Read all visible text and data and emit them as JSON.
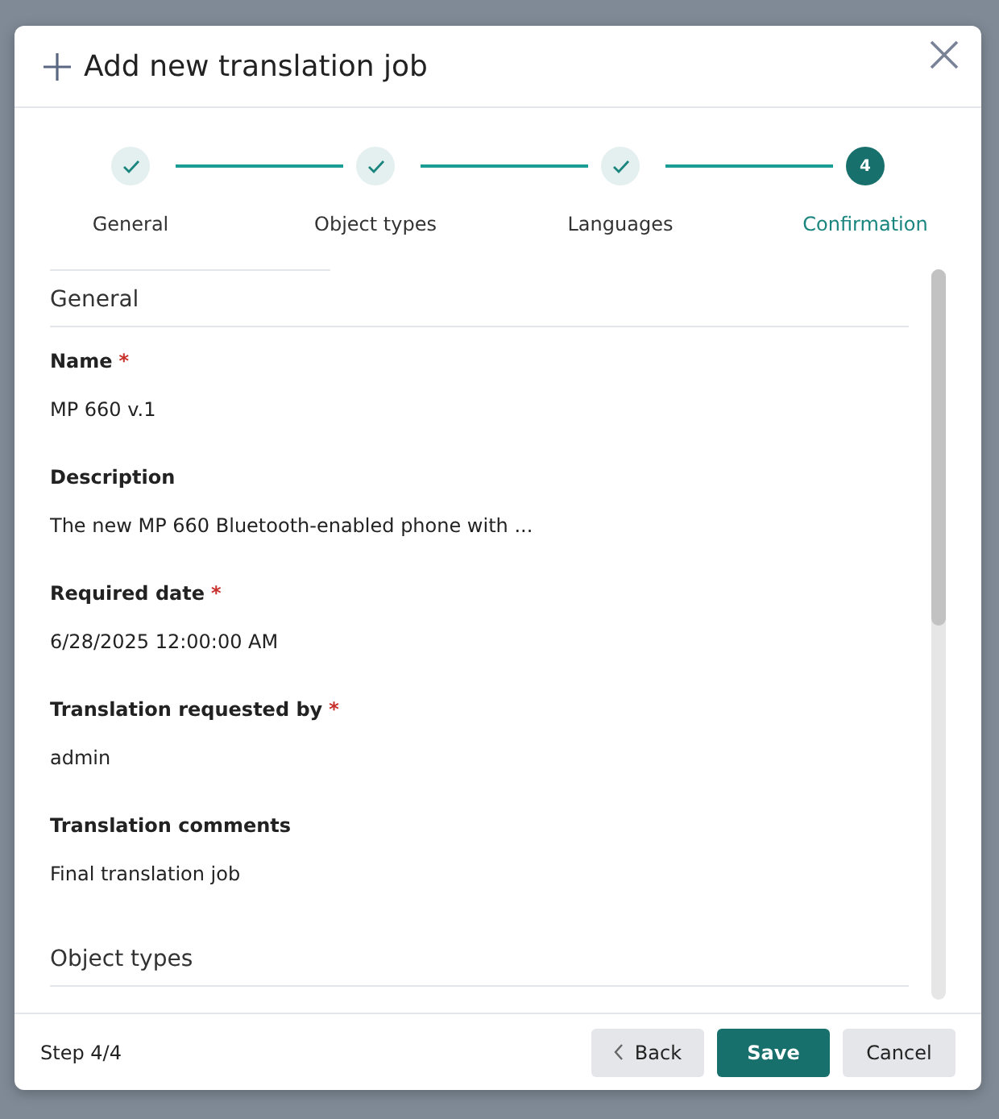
{
  "dialog": {
    "title": "Add new translation job"
  },
  "steps": [
    {
      "label": "General",
      "completed": true,
      "selected": false
    },
    {
      "label": "Object types",
      "completed": true,
      "selected": false
    },
    {
      "label": "Languages",
      "completed": true,
      "selected": false
    },
    {
      "label": "Confirmation",
      "completed": false,
      "selected": true,
      "number": "4"
    }
  ],
  "sections": [
    {
      "title": "General",
      "fields": [
        {
          "label": "Name",
          "required_mark": "*",
          "value": "MP 660 v.1"
        },
        {
          "label": "Description",
          "value": "The new MP 660 Bluetooth-enabled phone with ..."
        },
        {
          "label": "Required date",
          "required_mark": "*",
          "value": "6/28/2025 12:00:00 AM"
        },
        {
          "label": "Translation requested by",
          "required_mark": "*",
          "value": "admin"
        },
        {
          "label": "Translation comments",
          "value": "Final translation job"
        }
      ]
    },
    {
      "title": "Object types"
    }
  ],
  "footer": {
    "step": "Step 4/4",
    "buttons": [
      {
        "label": "Back",
        "kind": "back"
      },
      {
        "label": "Save",
        "kind": "primary"
      },
      {
        "label": "Cancel",
        "kind": "secondary"
      }
    ]
  }
}
